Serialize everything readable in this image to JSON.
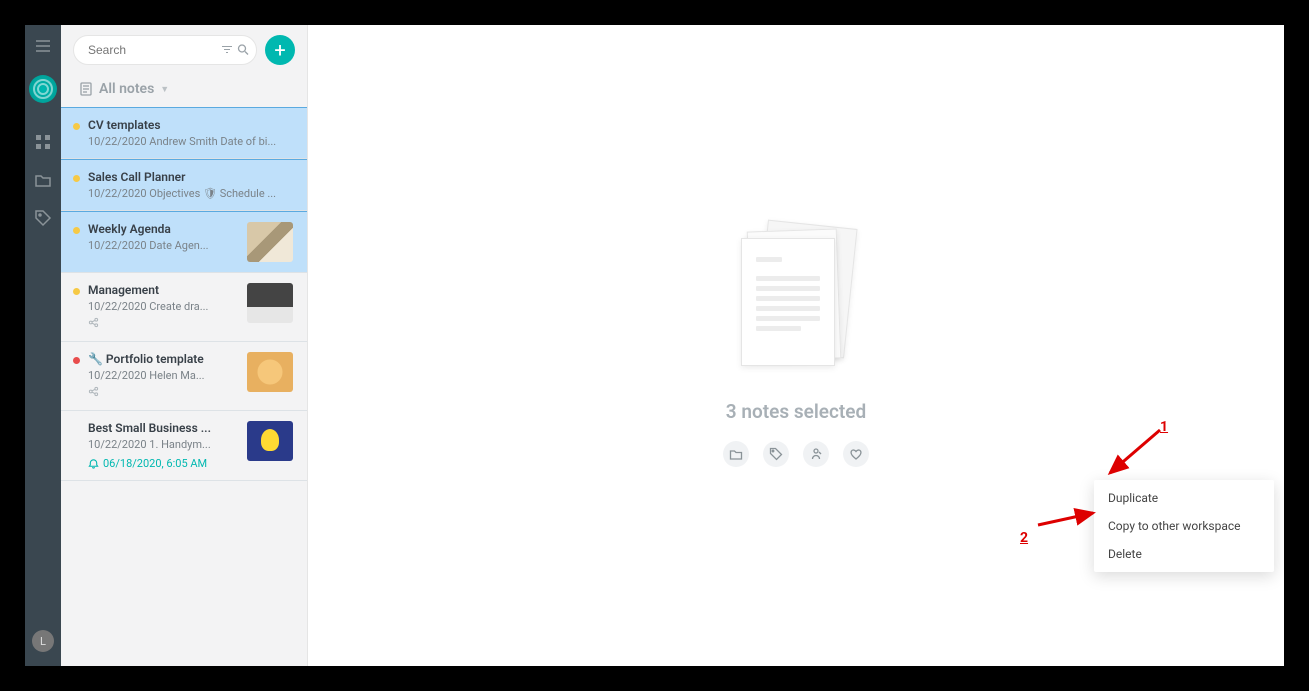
{
  "search": {
    "placeholder": "Search"
  },
  "list_header": "All notes",
  "add_label": "+",
  "avatar_letter": "L",
  "notes": [
    {
      "title": "CV templates",
      "snippet": "10/22/2020 Andrew Smith Date of bi...",
      "selected": true,
      "dot": "yellow"
    },
    {
      "title": "Sales Call Planner",
      "snippet": "10/22/2020 Objectives 🛡 Schedule ...",
      "selected": true,
      "dot": "yellow"
    },
    {
      "title": "Weekly Agenda",
      "snippet": "10/22/2020 Date Agen...",
      "selected": true,
      "dot": "yellow",
      "thumb": "notebook"
    },
    {
      "title": "Management",
      "snippet": "10/22/2020 Create dra...",
      "selected": false,
      "dot": "yellow",
      "thumb": "laptop",
      "share": true
    },
    {
      "title": "🔧 Portfolio template",
      "snippet": "10/22/2020 Helen Ma...",
      "selected": false,
      "dot": "red",
      "thumb": "monkey",
      "share": true
    },
    {
      "title": "Best Small Business ...",
      "snippet": "10/22/2020 1. Handym...",
      "selected": false,
      "dot": "",
      "thumb": "idea",
      "reminder": "06/18/2020, 6:05 AM"
    }
  ],
  "main": {
    "selected_text": "3 notes selected",
    "context_menu": [
      "Duplicate",
      "Copy to other workspace",
      "Delete"
    ]
  },
  "annotations": {
    "a1": "1",
    "a2": "2"
  }
}
